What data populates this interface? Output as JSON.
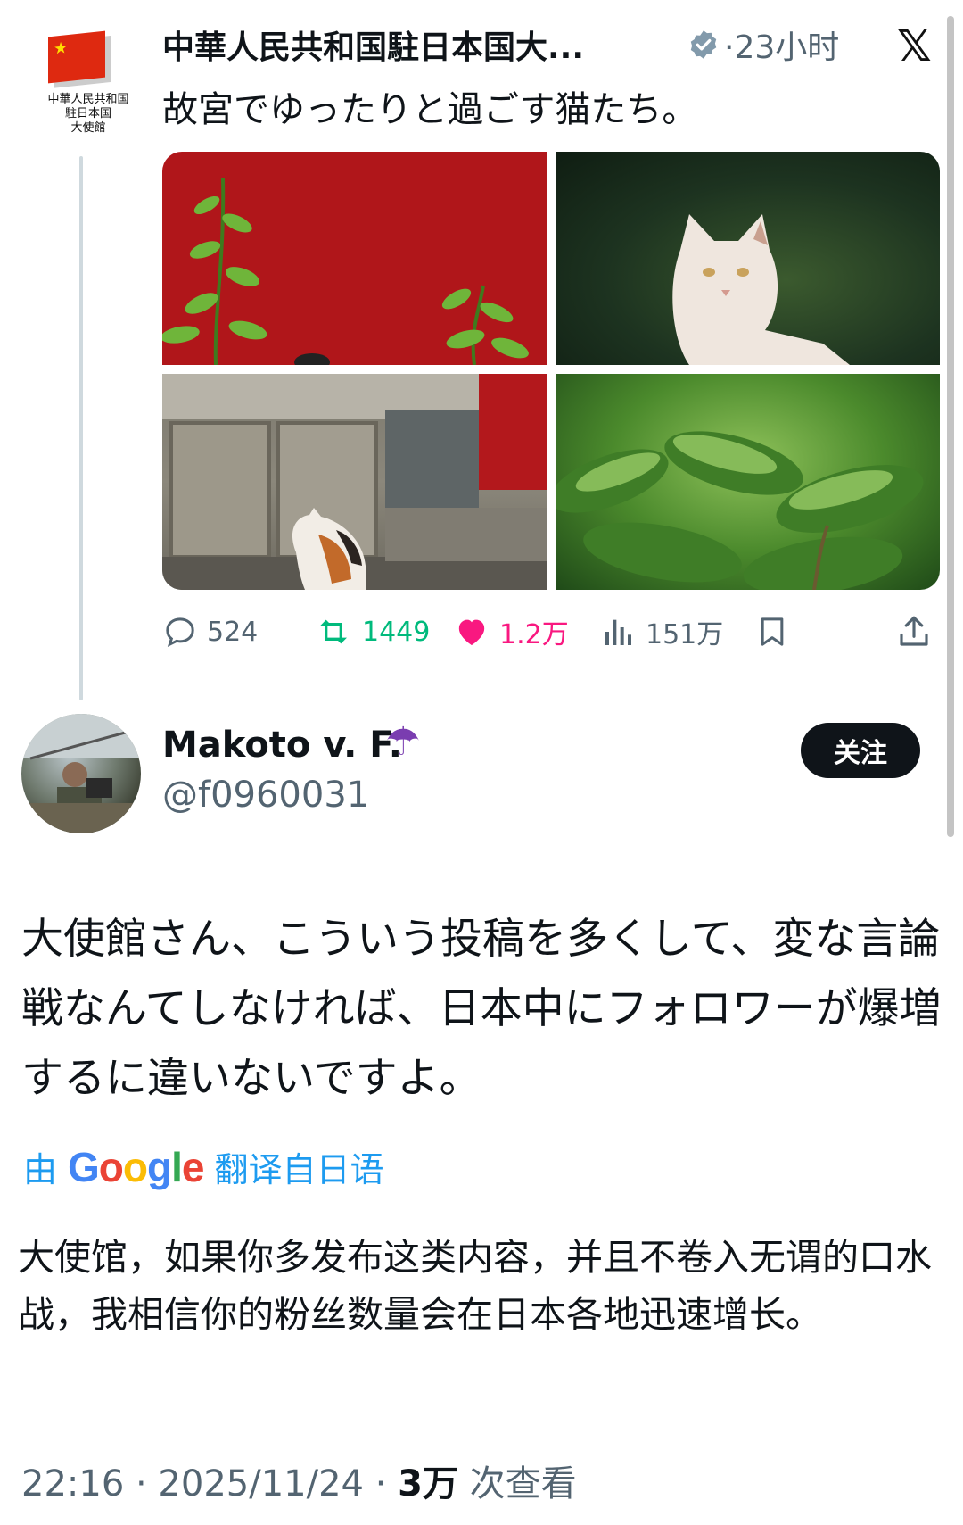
{
  "quoted": {
    "avatar_label": "中華人民共和国\n駐日本国\n大使館",
    "name": "中華人民共和国駐日本国大...",
    "time": "·23小时",
    "text": "故宮でゆったりと過ごす猫たち。",
    "images": [
      "red-wall-plants",
      "white-cat-garden",
      "calico-cat-stone-wall",
      "green-leaves"
    ],
    "stats": {
      "replies": "524",
      "retweets": "1449",
      "likes": "1.2万",
      "views": "151万"
    },
    "colors": {
      "retweet": "#00ba7c",
      "like": "#f91880",
      "muted": "#536471"
    }
  },
  "reply": {
    "name": "Makoto v. F.",
    "handle": "@f0960031",
    "follow_label": "关注",
    "text": "大使館さん、こういう投稿を多くして、変な言論戦なんてしなければ、日本中にフォロワーが爆増するに違いないですよ。",
    "translate": {
      "prefix": "由",
      "brand": "Google",
      "suffix": "翻译自日语"
    },
    "translation": "大使馆，如果你多发布这类内容，并且不卷入无谓的口水战，我相信你的粉丝数量会在日本各地迅速增长。",
    "meta": {
      "time": "22:16 · 2025/11/24 · ",
      "views_count": "3万",
      "views_label": " 次查看"
    }
  }
}
